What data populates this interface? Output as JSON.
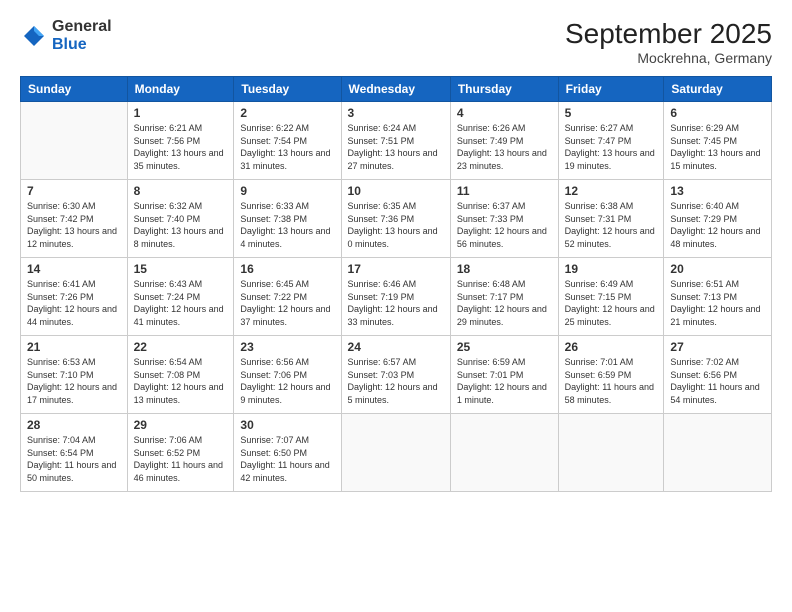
{
  "header": {
    "logo": {
      "general": "General",
      "blue": "Blue"
    },
    "title": "September 2025",
    "location": "Mockrehna, Germany"
  },
  "weekdays": [
    "Sunday",
    "Monday",
    "Tuesday",
    "Wednesday",
    "Thursday",
    "Friday",
    "Saturday"
  ],
  "weeks": [
    [
      null,
      {
        "day": "1",
        "sunrise": "6:21 AM",
        "sunset": "7:56 PM",
        "daylight": "13 hours and 35 minutes."
      },
      {
        "day": "2",
        "sunrise": "6:22 AM",
        "sunset": "7:54 PM",
        "daylight": "13 hours and 31 minutes."
      },
      {
        "day": "3",
        "sunrise": "6:24 AM",
        "sunset": "7:51 PM",
        "daylight": "13 hours and 27 minutes."
      },
      {
        "day": "4",
        "sunrise": "6:26 AM",
        "sunset": "7:49 PM",
        "daylight": "13 hours and 23 minutes."
      },
      {
        "day": "5",
        "sunrise": "6:27 AM",
        "sunset": "7:47 PM",
        "daylight": "13 hours and 19 minutes."
      },
      {
        "day": "6",
        "sunrise": "6:29 AM",
        "sunset": "7:45 PM",
        "daylight": "13 hours and 15 minutes."
      }
    ],
    [
      {
        "day": "7",
        "sunrise": "6:30 AM",
        "sunset": "7:42 PM",
        "daylight": "13 hours and 12 minutes."
      },
      {
        "day": "8",
        "sunrise": "6:32 AM",
        "sunset": "7:40 PM",
        "daylight": "13 hours and 8 minutes."
      },
      {
        "day": "9",
        "sunrise": "6:33 AM",
        "sunset": "7:38 PM",
        "daylight": "13 hours and 4 minutes."
      },
      {
        "day": "10",
        "sunrise": "6:35 AM",
        "sunset": "7:36 PM",
        "daylight": "13 hours and 0 minutes."
      },
      {
        "day": "11",
        "sunrise": "6:37 AM",
        "sunset": "7:33 PM",
        "daylight": "12 hours and 56 minutes."
      },
      {
        "day": "12",
        "sunrise": "6:38 AM",
        "sunset": "7:31 PM",
        "daylight": "12 hours and 52 minutes."
      },
      {
        "day": "13",
        "sunrise": "6:40 AM",
        "sunset": "7:29 PM",
        "daylight": "12 hours and 48 minutes."
      }
    ],
    [
      {
        "day": "14",
        "sunrise": "6:41 AM",
        "sunset": "7:26 PM",
        "daylight": "12 hours and 44 minutes."
      },
      {
        "day": "15",
        "sunrise": "6:43 AM",
        "sunset": "7:24 PM",
        "daylight": "12 hours and 41 minutes."
      },
      {
        "day": "16",
        "sunrise": "6:45 AM",
        "sunset": "7:22 PM",
        "daylight": "12 hours and 37 minutes."
      },
      {
        "day": "17",
        "sunrise": "6:46 AM",
        "sunset": "7:19 PM",
        "daylight": "12 hours and 33 minutes."
      },
      {
        "day": "18",
        "sunrise": "6:48 AM",
        "sunset": "7:17 PM",
        "daylight": "12 hours and 29 minutes."
      },
      {
        "day": "19",
        "sunrise": "6:49 AM",
        "sunset": "7:15 PM",
        "daylight": "12 hours and 25 minutes."
      },
      {
        "day": "20",
        "sunrise": "6:51 AM",
        "sunset": "7:13 PM",
        "daylight": "12 hours and 21 minutes."
      }
    ],
    [
      {
        "day": "21",
        "sunrise": "6:53 AM",
        "sunset": "7:10 PM",
        "daylight": "12 hours and 17 minutes."
      },
      {
        "day": "22",
        "sunrise": "6:54 AM",
        "sunset": "7:08 PM",
        "daylight": "12 hours and 13 minutes."
      },
      {
        "day": "23",
        "sunrise": "6:56 AM",
        "sunset": "7:06 PM",
        "daylight": "12 hours and 9 minutes."
      },
      {
        "day": "24",
        "sunrise": "6:57 AM",
        "sunset": "7:03 PM",
        "daylight": "12 hours and 5 minutes."
      },
      {
        "day": "25",
        "sunrise": "6:59 AM",
        "sunset": "7:01 PM",
        "daylight": "12 hours and 1 minute."
      },
      {
        "day": "26",
        "sunrise": "7:01 AM",
        "sunset": "6:59 PM",
        "daylight": "11 hours and 58 minutes."
      },
      {
        "day": "27",
        "sunrise": "7:02 AM",
        "sunset": "6:56 PM",
        "daylight": "11 hours and 54 minutes."
      }
    ],
    [
      {
        "day": "28",
        "sunrise": "7:04 AM",
        "sunset": "6:54 PM",
        "daylight": "11 hours and 50 minutes."
      },
      {
        "day": "29",
        "sunrise": "7:06 AM",
        "sunset": "6:52 PM",
        "daylight": "11 hours and 46 minutes."
      },
      {
        "day": "30",
        "sunrise": "7:07 AM",
        "sunset": "6:50 PM",
        "daylight": "11 hours and 42 minutes."
      },
      null,
      null,
      null,
      null
    ]
  ]
}
